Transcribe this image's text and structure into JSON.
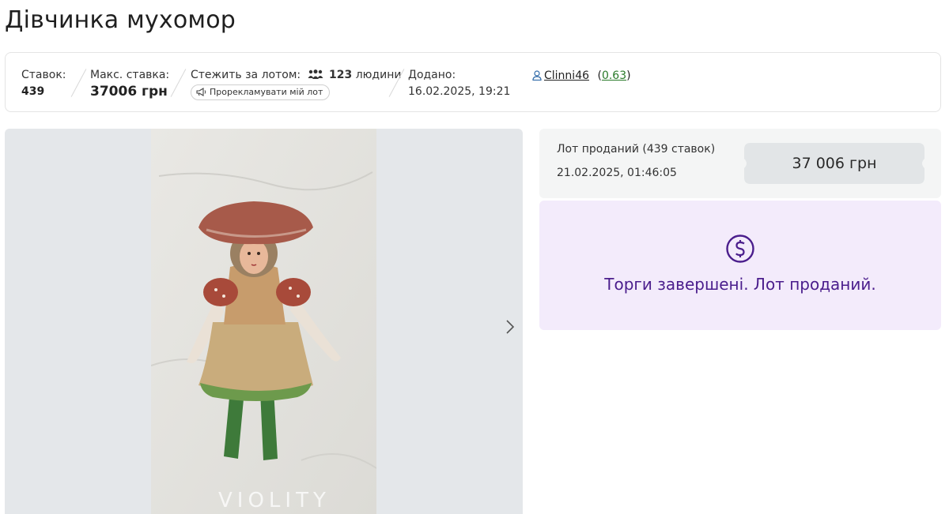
{
  "lot": {
    "title": "Дівчинка мухомор"
  },
  "info": {
    "bids_label": "Ставок:",
    "bids_value": "439",
    "max_bid_label": "Макс. ставка:",
    "max_bid_value": "37006 грн",
    "watchers_label": "Стежить за лотом:",
    "watchers_count": "123",
    "watchers_unit": "людини",
    "promote_label": "Прорекламувати мій лот",
    "added_label": "Додано:",
    "added_date": "16.02.2025, 19:21",
    "seller_name": "Clinni46",
    "seller_rating_open": "(",
    "seller_rating": "0.63",
    "seller_rating_close": ")"
  },
  "gallery": {
    "watermark": "VIOLITY"
  },
  "sale": {
    "status": "Лот проданий (439 ставок)",
    "date": "21.02.2025, 01:46:05",
    "price": "37 006 грн"
  },
  "notice": {
    "message": "Торги завершені. Лот проданий."
  },
  "colors": {
    "accent_purple": "#4a1d8c",
    "notice_bg": "#f3ebfb",
    "rating_green": "#2a7a2a"
  }
}
